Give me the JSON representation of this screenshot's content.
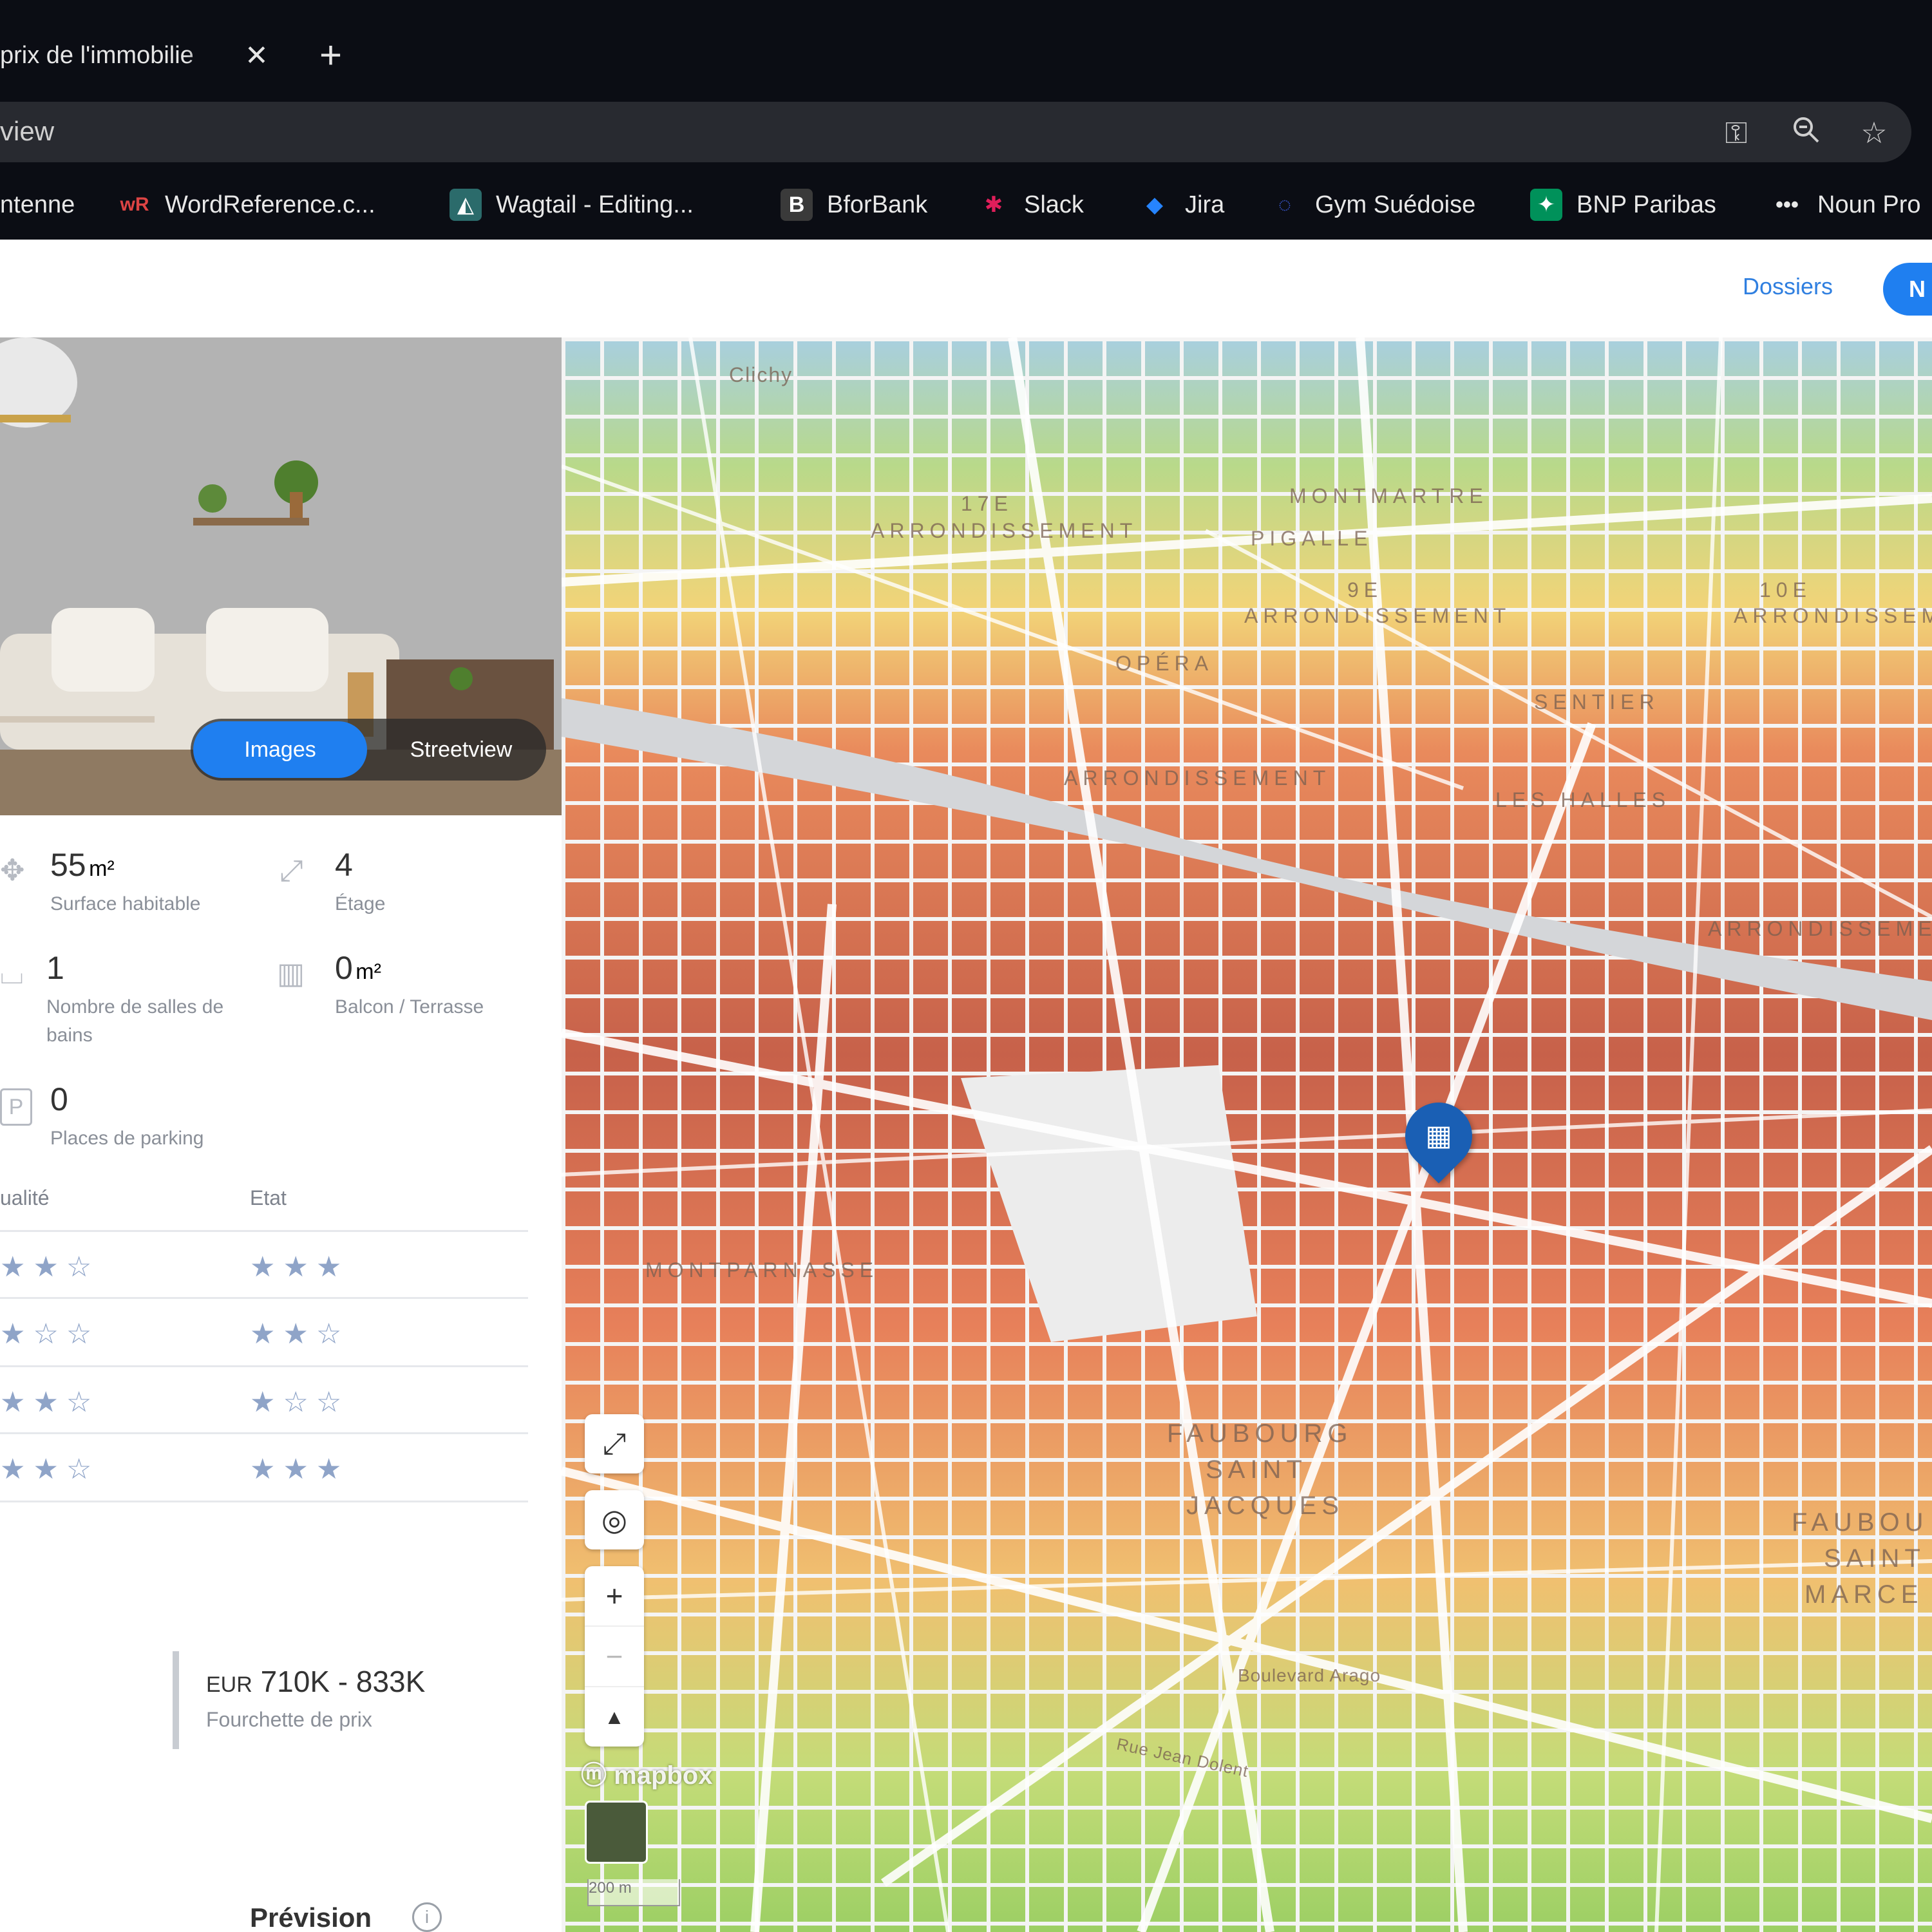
{
  "browser": {
    "tab_title": "prix de l'immobilie",
    "close_symbol": "✕",
    "new_tab_symbol": "+",
    "address": "view",
    "bookmarks": [
      {
        "label": "ntenne"
      },
      {
        "label": "WordReference.c..."
      },
      {
        "label": "Wagtail - Editing..."
      },
      {
        "label": "BforBank"
      },
      {
        "label": "Slack"
      },
      {
        "label": "Jira"
      },
      {
        "label": "Gym Suédoise"
      },
      {
        "label": "BNP Paribas"
      },
      {
        "label": "Noun Pro"
      }
    ]
  },
  "header": {
    "dossiers": "Dossiers",
    "new_button": "N"
  },
  "photo_toggle": {
    "images": "Images",
    "streetview": "Streetview"
  },
  "features": {
    "surface": {
      "value": "55",
      "unit": "m²",
      "label": "Surface habitable"
    },
    "etage": {
      "value": "4",
      "label": "Étage"
    },
    "sdb": {
      "value": "1",
      "label": "Nombre de salles de bains"
    },
    "balcon": {
      "value": "0",
      "unit": "m²",
      "label": "Balcon / Terrasse"
    },
    "parking": {
      "value": "0",
      "label": "Places de parking"
    }
  },
  "ratings": {
    "col1": "ualité",
    "col2": "Etat",
    "rows": [
      {
        "qualite": "★★☆",
        "etat": "★★★"
      },
      {
        "qualite": "★☆☆",
        "etat": "★★☆"
      },
      {
        "qualite": "★★☆",
        "etat": "★☆☆"
      },
      {
        "qualite": "★★☆",
        "etat": "★★★"
      }
    ]
  },
  "price": {
    "currency": "EUR",
    "range": "710K - 833K",
    "label": "Fourchette de prix"
  },
  "prevision": {
    "title": "Prévision",
    "info": "i"
  },
  "map": {
    "labels": [
      "Clichy",
      "17E",
      "ARRONDISSEMENT",
      "MONTMARTRE",
      "PIGALLE",
      "9E",
      "ARRONDISSEMENT",
      "SENTIER",
      "LES HALLES",
      "ARRONDISSEMENT",
      "FAUBOURG",
      "SAINT",
      "JACQUES",
      "FAUBOU",
      "SAINT",
      "MARCE",
      "Boulevard Arago",
      "Rue Jean Dolent",
      "MONTPARNASSE",
      "ARRONDISSEMENT",
      "OPÉRA",
      "10E",
      "ARRONDISSEMENT"
    ],
    "controls": [
      "⤢",
      "◎",
      "+",
      "−",
      "▲"
    ],
    "attribution": "mapbox",
    "scale": "200 m"
  }
}
